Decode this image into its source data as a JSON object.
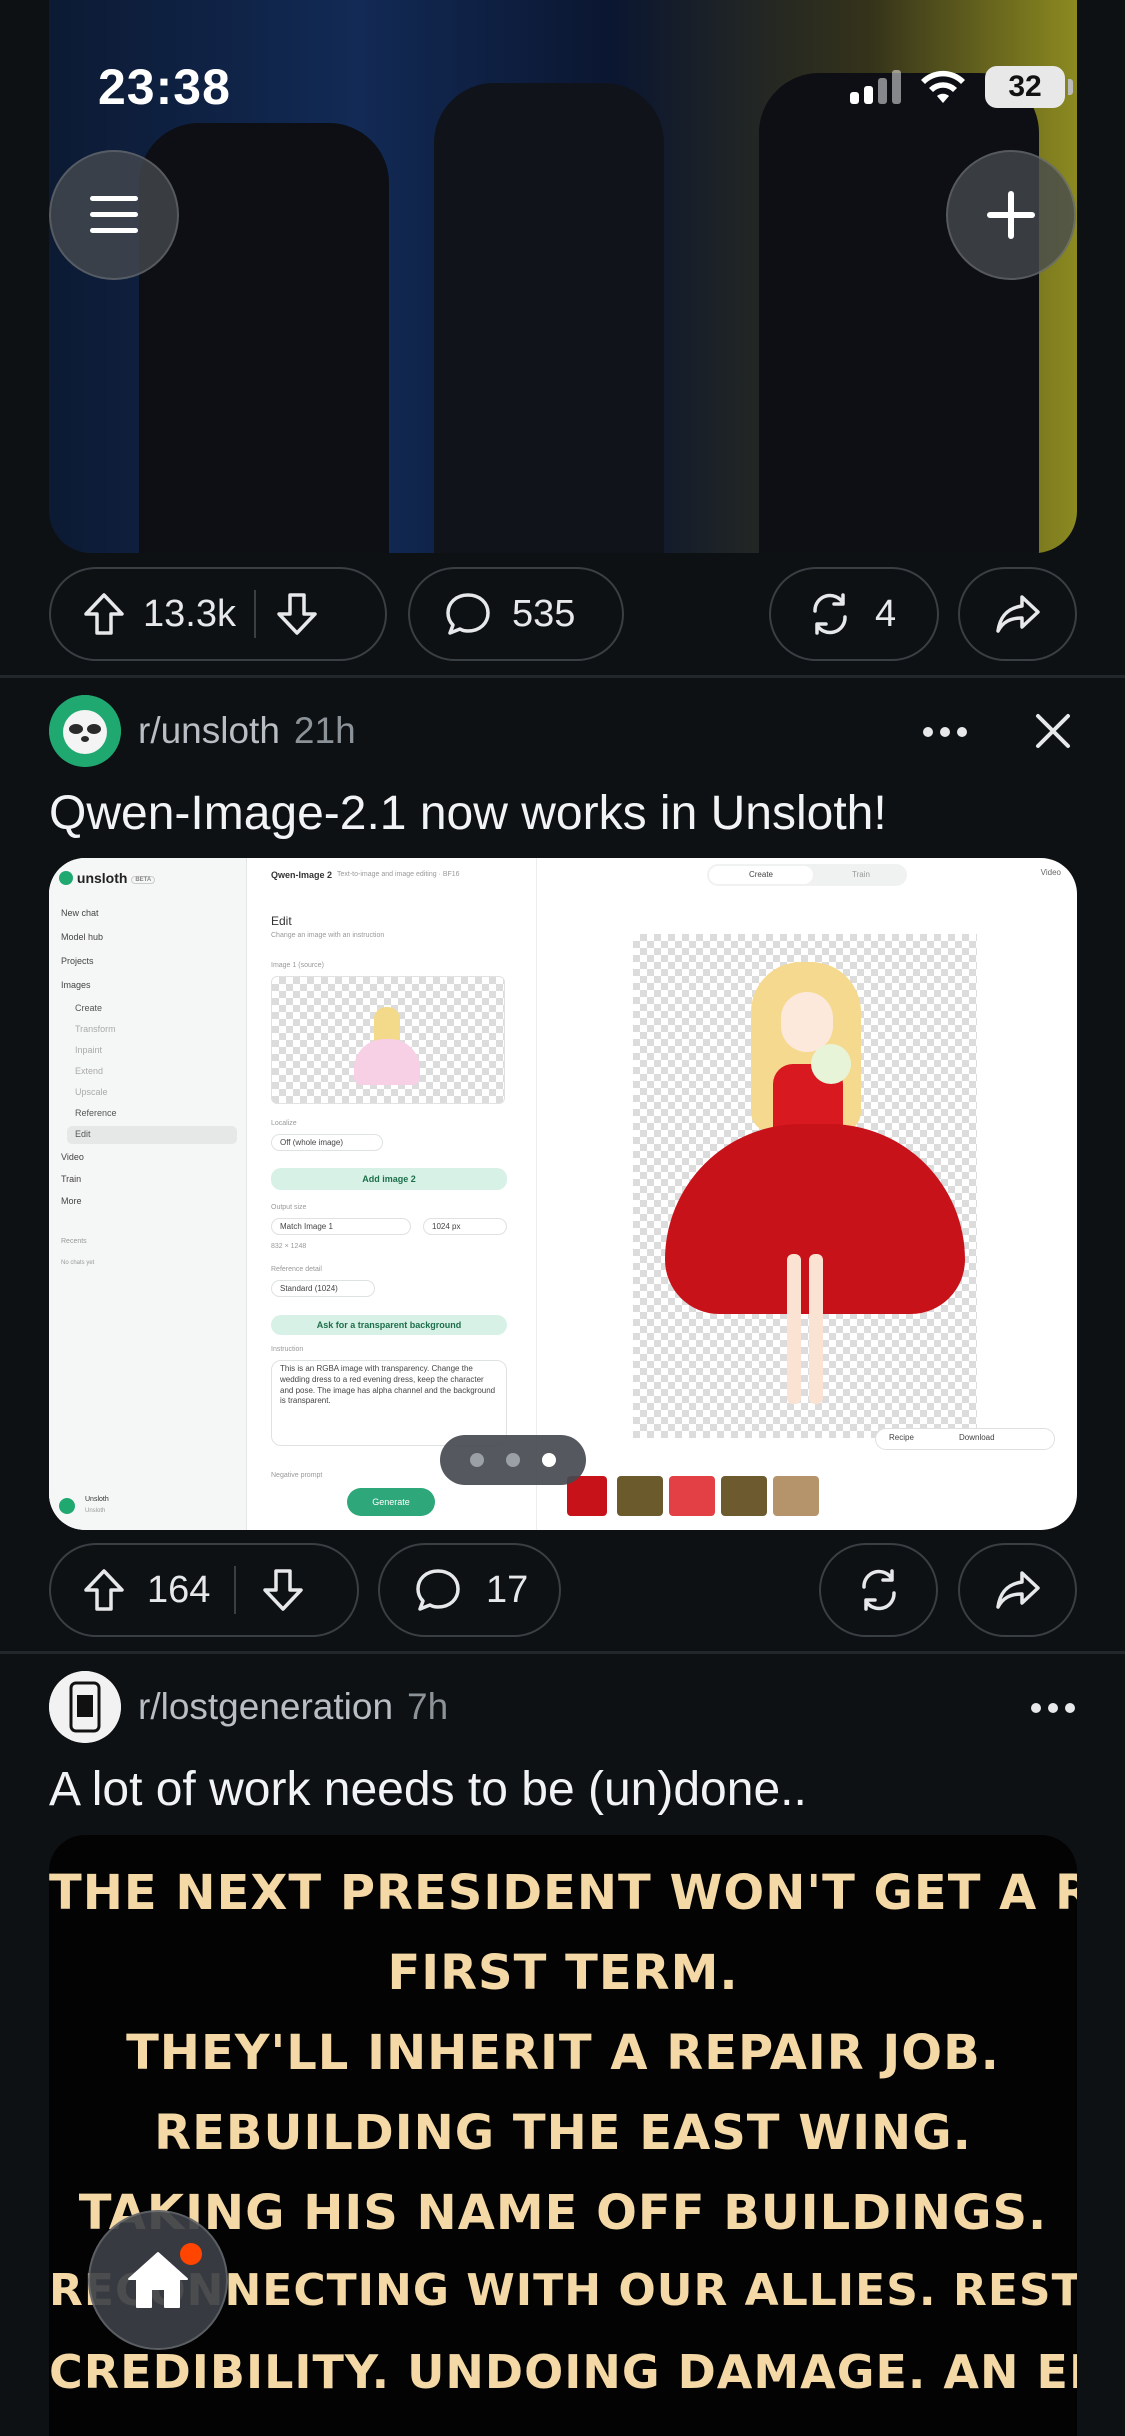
{
  "status_bar": {
    "time": "23:38",
    "battery": "32"
  },
  "post1_actions": {
    "upvotes": "13.3k",
    "comments": "535",
    "crossposts": "4"
  },
  "post2": {
    "subreddit": "r/unsloth",
    "age": "21h",
    "title": "Qwen-Image-2.1 now works in Unsloth!",
    "upvotes": "164",
    "comments": "17",
    "carousel": {
      "pages": 3,
      "current": 3
    },
    "screenshot": {
      "app_name": "unsloth",
      "app_badge": "BETA",
      "sidebar": [
        "New chat",
        "Model hub",
        "Projects",
        "Images"
      ],
      "images_sub": [
        "Create",
        "Transform",
        "Inpaint",
        "Extend",
        "Upscale",
        "Reference",
        "Edit"
      ],
      "sidebar_more": [
        "Video",
        "Train",
        "More"
      ],
      "recents_label": "Recents",
      "recents_empty": "No chats yet",
      "user_name": "Unsloth",
      "user_sub": "Unsloth",
      "model_title": "Qwen-Image 2",
      "model_subtitle": "Text-to-image and image editing · BF16",
      "tabs": [
        "Create",
        "Train"
      ],
      "video_label": "Video",
      "edit_title": "Edit",
      "edit_subtitle": "Change an image with an instruction",
      "source_label": "Image 1 (source)",
      "localize_label": "Localize",
      "localize_value": "Off (whole image)",
      "add_image": "Add image 2",
      "output_label": "Output size",
      "output_value": "Match Image 1",
      "output_px": "1024 px",
      "output_dims": "832 × 1248",
      "ref_label": "Reference detail",
      "ref_value": "Standard (1024)",
      "transparent_btn": "Ask for a transparent background",
      "instruction_label": "Instruction",
      "instruction_text": "This is an RGBA image with transparency. Change the wedding dress to a red evening dress, keep the character and pose. The image has alpha channel and the background is transparent.",
      "negative_label": "Negative prompt",
      "generate": "Generate",
      "recipe": "Recipe",
      "download": "Download"
    }
  },
  "post3": {
    "subreddit": "r/lostgeneration",
    "age": "7h",
    "title": "A lot of work needs to be (un)done..",
    "image_lines": [
      "THE NEXT PRESIDENT WON'T GET A REAL",
      "FIRST TERM.",
      "THEY'LL INHERIT A REPAIR JOB.",
      "REBUILDING THE EAST WING.",
      "TAKING HIS NAME OFF BUILDINGS.",
      "RECONNECTING WITH OUR ALLIES. RESTORING",
      "CREDIBILITY. UNDOING DAMAGE. AN ENTIRE"
    ]
  },
  "colors": {
    "background": "#0e1113",
    "accent": "#ff4500",
    "text": "#e6e8ea",
    "muted": "#8b9298"
  },
  "icons": [
    "menu-icon",
    "plus-icon",
    "upvote-icon",
    "downvote-icon",
    "comment-icon",
    "crosspost-icon",
    "share-icon",
    "more-icon",
    "close-icon",
    "home-icon"
  ]
}
